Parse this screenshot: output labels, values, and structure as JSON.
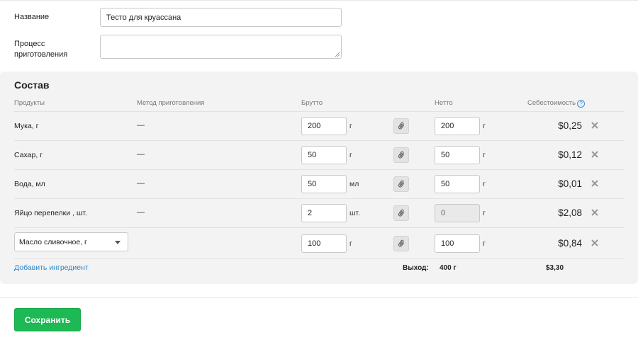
{
  "form": {
    "name_label": "Название",
    "name_value": "Тесто для круассана",
    "process_label_line1": "Процесс",
    "process_label_line2": "приготовления",
    "process_value": ""
  },
  "composition": {
    "title": "Состав",
    "headers": {
      "products": "Продукты",
      "method": "Метод приготовления",
      "gross": "Брутто",
      "net": "Нетто",
      "cost": "Себестоимость",
      "help_glyph": "?"
    },
    "rows": [
      {
        "product": "Мука, г",
        "method": "—",
        "gross": "200",
        "gross_unit": "г",
        "net": "200",
        "net_unit": "г",
        "cost": "$0,25"
      },
      {
        "product": "Сахар, г",
        "method": "—",
        "gross": "50",
        "gross_unit": "г",
        "net": "50",
        "net_unit": "г",
        "cost": "$0,12"
      },
      {
        "product": "Вода, мл",
        "method": "—",
        "gross": "50",
        "gross_unit": "мл",
        "net": "50",
        "net_unit": "г",
        "cost": "$0,01"
      },
      {
        "product": "Яйцо перепелки , шт.",
        "method": "—",
        "gross": "2",
        "gross_unit": "шт.",
        "net": "0",
        "net_unit": "г",
        "cost": "$2,08"
      },
      {
        "product": "Масло сливочное, г",
        "method": "",
        "gross": "100",
        "gross_unit": "г",
        "net": "100",
        "net_unit": "г",
        "cost": "$0,84"
      }
    ],
    "add_ingredient": "Добавить ингредиент",
    "yield_label": "Выход:",
    "yield_value": "400 г",
    "total_cost": "$3,30"
  },
  "actions": {
    "save_label": "Сохранить"
  },
  "colors": {
    "accent_green": "#1db954",
    "link_blue": "#2f86c9",
    "panel_bg": "#f3f3f3"
  }
}
